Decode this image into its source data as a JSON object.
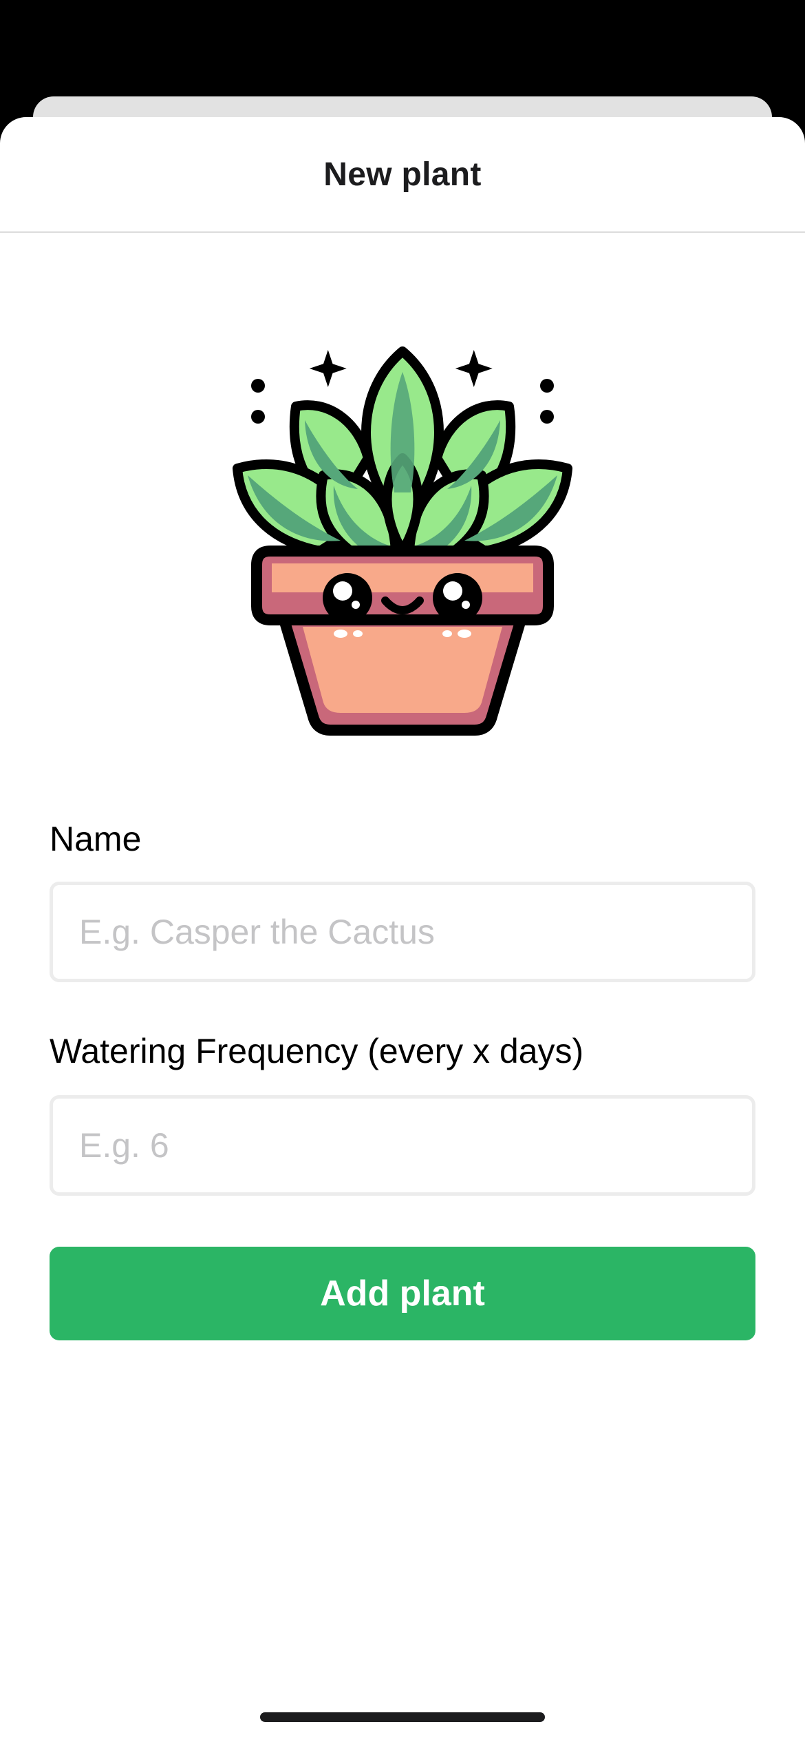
{
  "header": {
    "title": "New plant"
  },
  "illustration": {
    "icon": "potted-plant-illustration"
  },
  "form": {
    "name": {
      "label": "Name",
      "placeholder": "E.g. Casper the Cactus",
      "value": ""
    },
    "watering": {
      "label": "Watering Frequency (every x days)",
      "placeholder": "E.g. 6",
      "value": ""
    },
    "submit_label": "Add plant"
  },
  "colors": {
    "accent": "#2bb565",
    "placeholder": "#c4c4c6",
    "input_border": "#ececec",
    "pot": "#f8a98a",
    "pot_shade": "#c9687a",
    "leaf_light": "#98e98b",
    "leaf_dark": "#56a77a"
  }
}
